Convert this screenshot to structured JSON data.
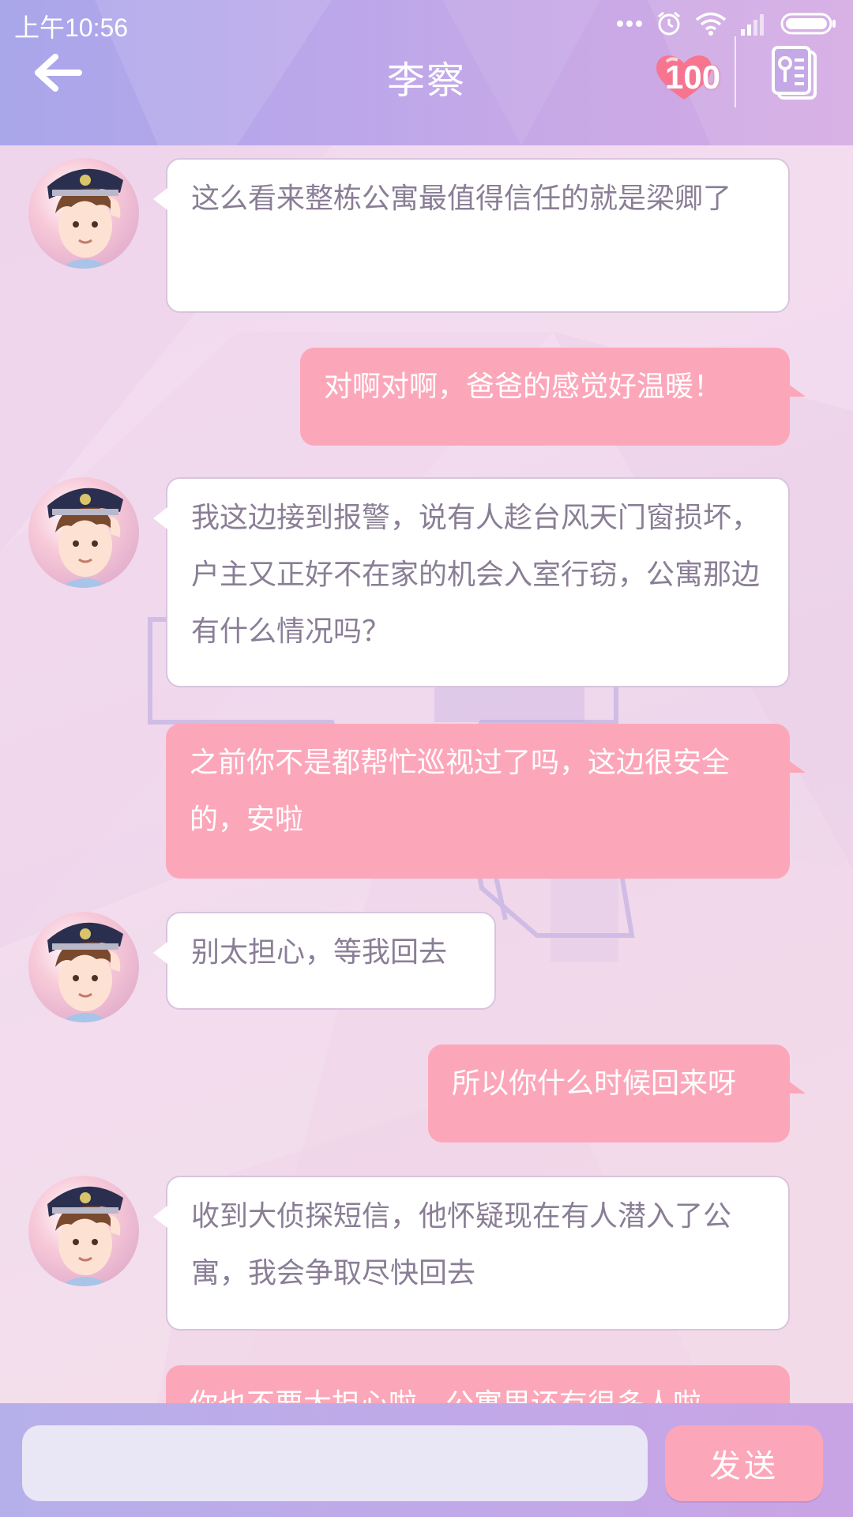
{
  "status_bar": {
    "time": "上午10:56",
    "icons": [
      "more-dots-icon",
      "alarm-icon",
      "wifi-icon",
      "signal-icon",
      "battery-icon"
    ]
  },
  "header": {
    "title": "李察",
    "affection_count": "100",
    "back_icon": "back-arrow-icon",
    "affection_icon": "heart-icon",
    "contact_card_icon": "contact-card-icon"
  },
  "messages": [
    {
      "sender": "contact",
      "text": "这么看来整栋公寓最值得信任的就是梁卿了"
    },
    {
      "sender": "me",
      "text": "对啊对啊，爸爸的感觉好温暖！"
    },
    {
      "sender": "contact",
      "text": "我这边接到报警，说有人趁台风天门窗损坏，户主又正好不在家的机会入室行窃，公寓那边有什么情况吗？"
    },
    {
      "sender": "me",
      "text": "之前你不是都帮忙巡视过了吗，这边很安全的，安啦"
    },
    {
      "sender": "contact",
      "text": "别太担心，等我回去"
    },
    {
      "sender": "me",
      "text": "所以你什么时候回来呀"
    },
    {
      "sender": "contact",
      "text": "收到大侦探短信，他怀疑现在有人潜入了公寓，我会争取尽快回去"
    },
    {
      "sender": "me",
      "text": "你也不要太担心啦，公寓里还有很多人啦"
    }
  ],
  "input": {
    "value": "",
    "placeholder": "",
    "send_label": "发送"
  },
  "colors": {
    "header_gradient_start": "#a9a6ea",
    "header_gradient_end": "#d4a9e3",
    "outgoing_bubble": "#fca7b9",
    "incoming_bubble": "#ffffff",
    "incoming_text": "#8a7e96"
  }
}
